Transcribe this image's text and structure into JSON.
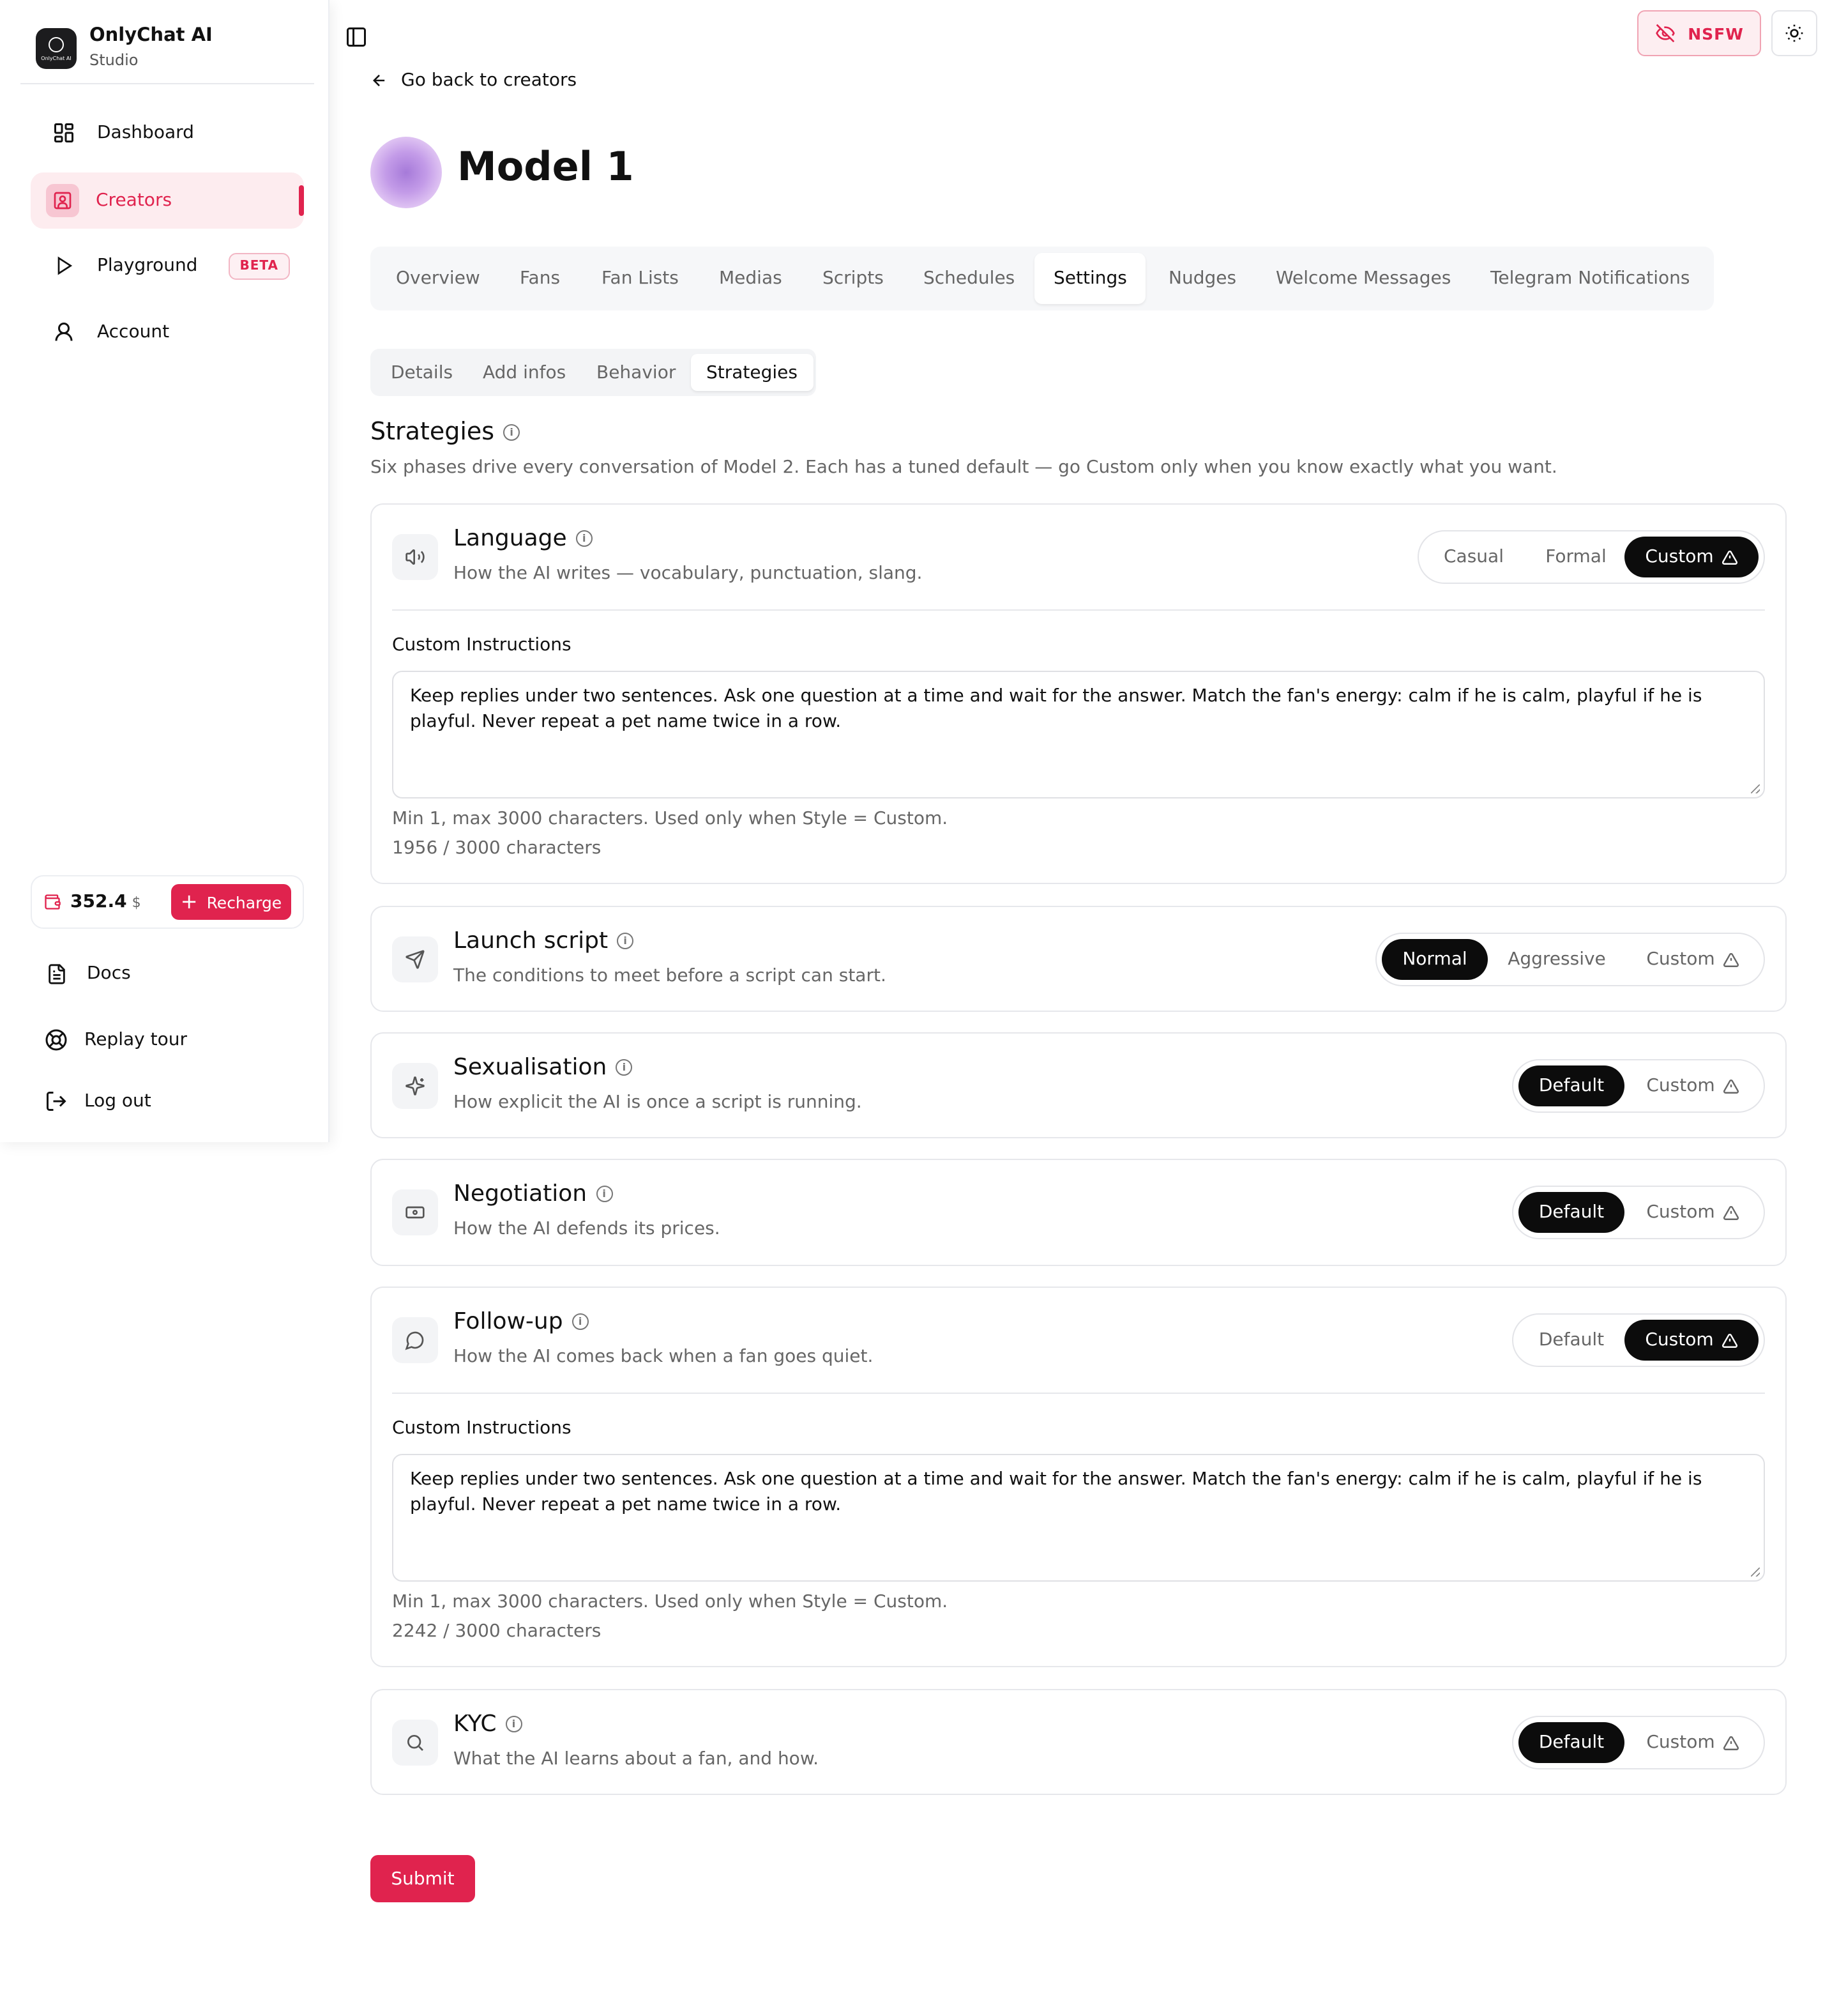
{
  "brand": {
    "name": "OnlyChat AI",
    "sub": "Studio",
    "logo_text": "OnlyChat AI"
  },
  "nav": {
    "dashboard": "Dashboard",
    "creators": "Creators",
    "playground": "Playground",
    "playground_badge": "BETA",
    "account": "Account"
  },
  "wallet": {
    "amount": "352.4",
    "currency": "$",
    "recharge_label": "Recharge"
  },
  "sidebar_footer": {
    "docs": "Docs",
    "replay_tour": "Replay tour",
    "log_out": "Log out"
  },
  "topbar": {
    "nsfw_label": "NSFW"
  },
  "page": {
    "back_label": "Go back to creators",
    "title": "Model 1",
    "tabs": [
      "Overview",
      "Fans",
      "Fan Lists",
      "Medias",
      "Scripts",
      "Schedules",
      "Settings",
      "Nudges",
      "Welcome Messages",
      "Telegram Notifications"
    ],
    "active_tab": "Settings",
    "subtabs": [
      "Details",
      "Add infos",
      "Behavior",
      "Strategies"
    ],
    "active_subtab": "Strategies"
  },
  "strategies": {
    "title": "Strategies",
    "description": "Six phases drive every conversation of Model 2. Each has a tuned default — go Custom only when you know exactly what you want.",
    "cards": [
      {
        "icon": "speaker-icon",
        "title": "Language",
        "description": "How the AI writes — vocabulary, punctuation, slang.",
        "options": [
          "Casual",
          "Formal",
          "Custom"
        ],
        "selected": "Custom",
        "custom_label": "Custom Instructions",
        "custom_text": "Keep replies under two sentences. Ask one question at a time and wait for the answer. Match the fan's energy: calm if he is calm, playful if he is playful. Never repeat a pet name twice in a row.",
        "hint": "Min 1, max 3000 characters. Used only when Style = Custom.",
        "count": "1956 / 3000 characters"
      },
      {
        "icon": "send-icon",
        "title": "Launch script",
        "description": "The conditions to meet before a script can start.",
        "options": [
          "Normal",
          "Aggressive",
          "Custom"
        ],
        "selected": "Normal"
      },
      {
        "icon": "sparkles-icon",
        "title": "Sexualisation",
        "description": "How explicit the AI is once a script is running.",
        "options": [
          "Default",
          "Custom"
        ],
        "selected": "Default"
      },
      {
        "icon": "banknote-icon",
        "title": "Negotiation",
        "description": "How the AI defends its prices.",
        "options": [
          "Default",
          "Custom"
        ],
        "selected": "Default"
      },
      {
        "icon": "message-circle-icon",
        "title": "Follow-up",
        "description": "How the AI comes back when a fan goes quiet.",
        "options": [
          "Default",
          "Custom"
        ],
        "selected": "Custom",
        "custom_label": "Custom Instructions",
        "custom_text": "Keep replies under two sentences. Ask one question at a time and wait for the answer. Match the fan's energy: calm if he is calm, playful if he is playful. Never repeat a pet name twice in a row.",
        "hint": "Min 1, max 3000 characters. Used only when Style = Custom.",
        "count": "2242 / 3000 characters"
      },
      {
        "icon": "search-icon",
        "title": "KYC",
        "description": "What the AI learns about a fan, and how.",
        "options": [
          "Default",
          "Custom"
        ],
        "selected": "Default"
      }
    ]
  },
  "submit_label": "Submit",
  "colors": {
    "accent": "#e0234e",
    "selected": "#0c0c0c"
  }
}
